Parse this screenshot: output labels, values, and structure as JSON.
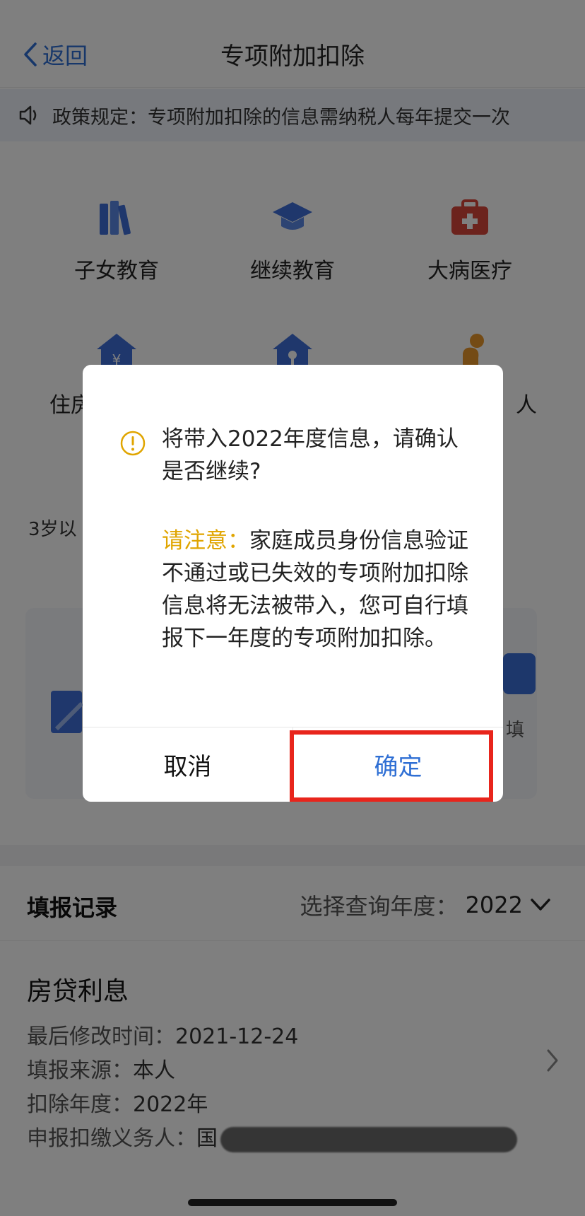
{
  "header": {
    "back_label": "返回",
    "title": "专项附加扣除"
  },
  "notice": {
    "text": "政策规定：专项附加扣除的信息需纳税人每年提交一次"
  },
  "categories": [
    {
      "label": "子女教育",
      "icon": "books-icon"
    },
    {
      "label": "继续教育",
      "icon": "graduation-cap-icon"
    },
    {
      "label": "大病医疗",
      "icon": "medical-kit-icon"
    },
    {
      "label": "住房",
      "icon": "house-yen-icon"
    },
    {
      "label": "",
      "icon": "house-key-icon"
    },
    {
      "label": "人",
      "icon": "elderly-icon"
    }
  ],
  "background_text": {
    "age_note": "3岁以",
    "card_right_label": "填"
  },
  "records": {
    "title": "填报记录",
    "year_label": "选择查询年度：",
    "year_value": "2022",
    "item": {
      "name": "房贷利息",
      "modified_label": "最后修改时间：",
      "modified_value": "2021-12-24",
      "source_label": "填报来源：",
      "source_value": "本人",
      "year_label": "扣除年度：",
      "year_value": "2022年",
      "agent_label": "申报扣缴义务人：",
      "agent_value_prefix": "国"
    }
  },
  "dialog": {
    "message": "将带入2022年度信息，请确认是否继续?",
    "note_prefix": "请注意：",
    "note_body": "家庭成员身份信息验证不通过或已失效的专项附加扣除信息将无法被带入，您可自行填报下一年度的专项附加扣除。",
    "cancel_label": "取消",
    "confirm_label": "确定"
  },
  "colors": {
    "accent": "#2f6fd4",
    "warning": "#e0a500",
    "highlight": "#e8251c",
    "icon_blue": "#3e6fd8",
    "icon_red": "#d9473b",
    "icon_orange": "#e8962a"
  }
}
